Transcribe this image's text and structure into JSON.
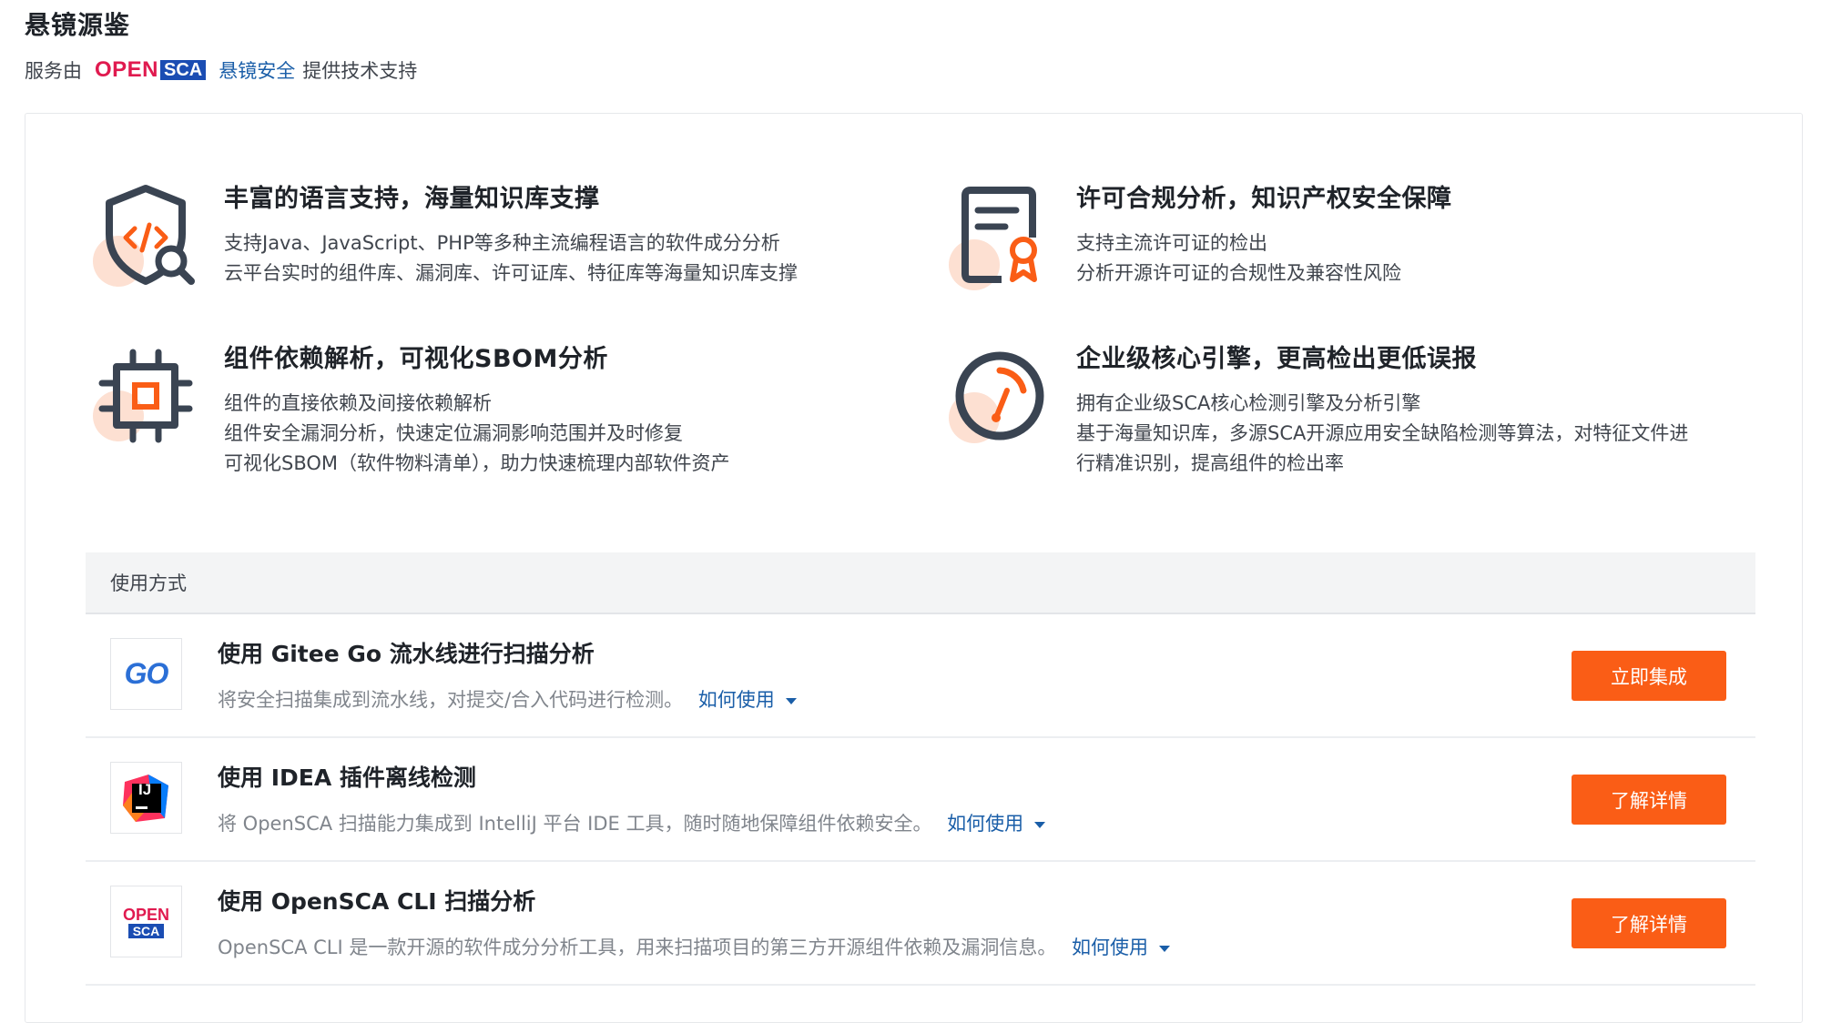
{
  "page": {
    "title": "悬镜源鉴"
  },
  "provider": {
    "prefix": "服务由",
    "logo_open": "OPEN",
    "logo_sca": "SCA",
    "link": "悬镜安全",
    "suffix": "提供技术支持"
  },
  "features": [
    {
      "icon": "shield-code-search-icon",
      "title": "丰富的语言支持，海量知识库支撑",
      "lines": [
        "支持Java、JavaScript、PHP等多种主流编程语言的软件成分分析",
        "云平台实时的组件库、漏洞库、许可证库、特征库等海量知识库支撑"
      ]
    },
    {
      "icon": "license-certificate-icon",
      "title": "许可合规分析，知识产权安全保障",
      "lines": [
        "支持主流许可证的检出",
        "分析开源许可证的合规性及兼容性风险"
      ]
    },
    {
      "icon": "chip-icon",
      "title": "组件依赖解析，可视化SBOM分析",
      "lines": [
        "组件的直接依赖及间接依赖解析",
        "组件安全漏洞分析，快速定位漏洞影响范围并及时修复",
        "可视化SBOM（软件物料清单），助力快速梳理内部软件资产"
      ]
    },
    {
      "icon": "gauge-icon",
      "title": "企业级核心引擎，更高检出更低误报",
      "lines": [
        "拥有企业级SCA核心检测引擎及分析引擎",
        "基于海量知识库，多源SCA开源应用安全缺陷检测等算法，对特征文件进",
        "行精准识别，提高组件的检出率"
      ]
    }
  ],
  "usage": {
    "header": "使用方式",
    "rows": [
      {
        "logo": "gitee-go-logo",
        "logo_text": "GO",
        "title": "使用 Gitee Go 流水线进行扫描分析",
        "desc": "将安全扫描集成到流水线，对提交/合入代码进行检测。",
        "how": "如何使用",
        "action": "立即集成"
      },
      {
        "logo": "intellij-idea-logo",
        "logo_text": "IJ",
        "title": "使用 IDEA 插件离线检测",
        "desc": "将 OpenSCA 扫描能力集成到 IntelliJ 平台 IDE 工具，随时随地保障组件依赖安全。",
        "how": "如何使用",
        "action": "了解详情"
      },
      {
        "logo": "opensca-logo",
        "logo_text": "OPEN",
        "logo_text2": "SCA",
        "title": "使用 OpenSCA CLI 扫描分析",
        "desc": "OpenSCA CLI 是一款开源的软件成分分析工具，用来扫描项目的第三方开源组件依赖及漏洞信息。",
        "how": "如何使用",
        "action": "了解详情"
      }
    ]
  },
  "colors": {
    "accent": "#fa5d16",
    "link": "#1a5ea8",
    "icon_dark": "#3a4452",
    "icon_soft": "#fde0d2"
  }
}
